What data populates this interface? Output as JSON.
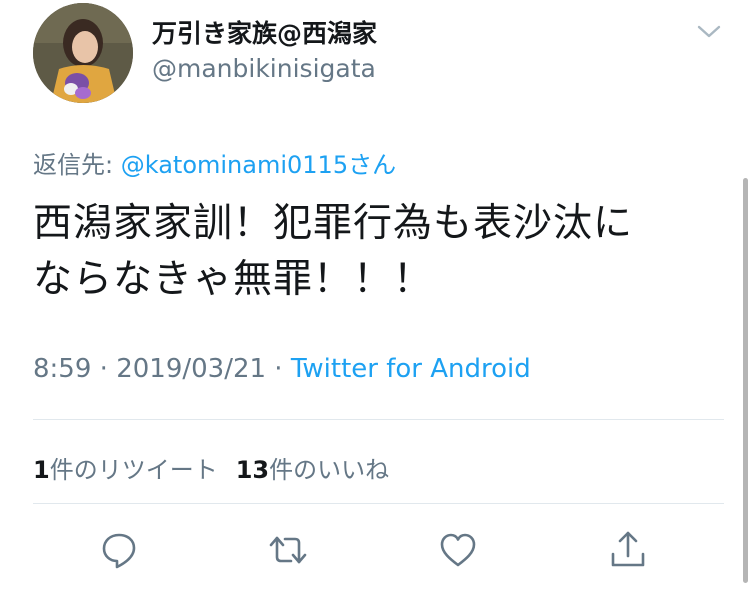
{
  "author": {
    "display_name": "万引き家族@西潟家",
    "handle": "@manbikinisigata"
  },
  "reply": {
    "prefix": "返信先: ",
    "mention": "@katominami0115さん"
  },
  "tweet": {
    "line1": "西潟家家訓！犯罪行為も表沙汰に",
    "line2": "ならなきゃ無罪！！！"
  },
  "meta": {
    "time": "8:59",
    "separator": " · ",
    "date": "2019/03/21",
    "source": "Twitter for Android"
  },
  "stats": {
    "retweet_count": "1",
    "retweet_label": "件のリツイート",
    "like_count": "13",
    "like_label": "件のいいね"
  },
  "icons": {
    "more": "chevron-down-icon",
    "reply": "reply-icon",
    "retweet": "retweet-icon",
    "like": "heart-icon",
    "share": "share-icon"
  },
  "colors": {
    "text": "#14171a",
    "secondary": "#657786",
    "accent": "#1da1f2",
    "divider": "#e1e8ed"
  }
}
